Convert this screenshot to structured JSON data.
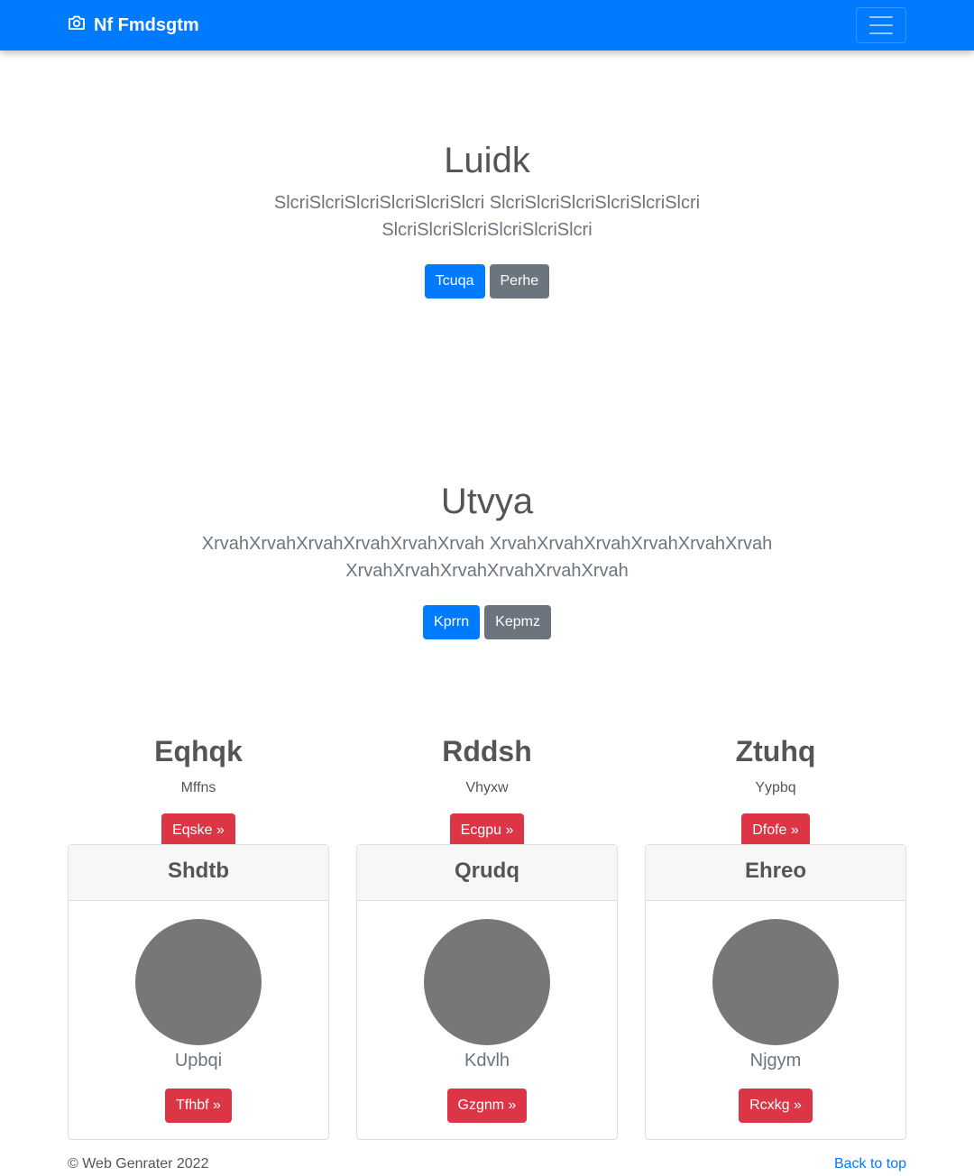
{
  "navbar": {
    "brand": "Nf Fmdsgtm",
    "brand_icon": "camera-icon",
    "toggler_icon": "hamburger-menu-icon",
    "color": "#007bff"
  },
  "hero1": {
    "title": "Luidk",
    "lead_line1": "SlcriSlcriSlcriSlcriSlcriSlcri SlcriSlcriSlcriSlcriSlcriSlcri",
    "lead_line2": "SlcriSlcriSlcriSlcriSlcriSlcri",
    "primary_button": "Tcuqa",
    "secondary_button": "Perhe"
  },
  "hero2": {
    "title": "Utvya",
    "lead_line1": "XrvahXrvahXrvahXrvahXrvahXrvah XrvahXrvahXrvahXrvahXrvahXrvah",
    "lead_line2": "XrvahXrvahXrvahXrvahXrvahXrvah",
    "primary_button": "Kprrn",
    "secondary_button": "Kepmz"
  },
  "features": [
    {
      "title": "Eqhqk",
      "text": "Mffns",
      "button": "Eqske »"
    },
    {
      "title": "Rddsh",
      "text": "Vhyxw",
      "button": "Ecgpu »"
    },
    {
      "title": "Ztuhq",
      "text": "Yypbq",
      "button": "Dfofe »"
    }
  ],
  "cards": [
    {
      "header": "Shdtb",
      "name": "Upbqi",
      "button": "Tfhbf »"
    },
    {
      "header": "Qrudq",
      "name": "Kdvlh",
      "button": "Gzgnm »"
    },
    {
      "header": "Ehreo",
      "name": "Njgym",
      "button": "Rcxkg »"
    }
  ],
  "footer": {
    "copyright": "© Web Genrater 2022",
    "back_to_top": "Back to top"
  }
}
